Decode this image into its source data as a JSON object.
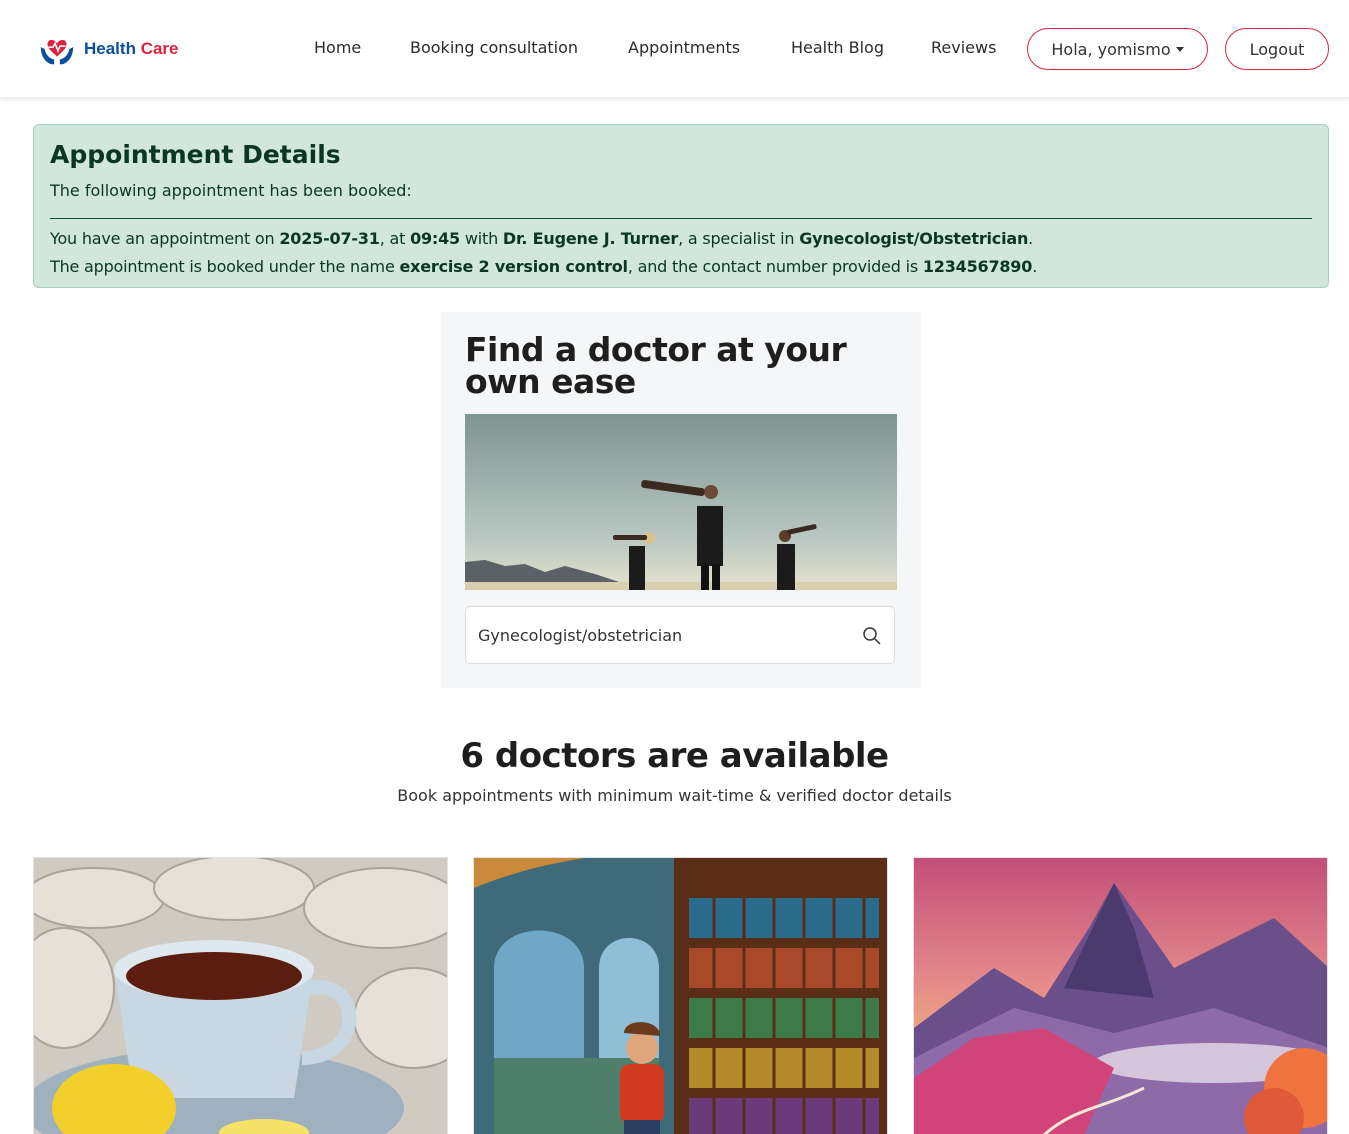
{
  "brand": {
    "icon": "heart-hands-logo",
    "name_part1": "Health",
    "name_part2": "Care"
  },
  "nav": {
    "links": [
      "Home",
      "Booking consultation",
      "Appointments",
      "Health Blog",
      "Reviews"
    ],
    "user_menu": "Hola, yomismo",
    "logout": "Logout"
  },
  "alert": {
    "title": "Appointment Details",
    "subtitle": "The following appointment has been booked:",
    "line1": {
      "prefix": "You have an appointment on ",
      "date": "2025-07-31",
      "at": ", at ",
      "time": "09:45",
      "with": " with ",
      "doctor": "Dr. Eugene J. Turner",
      "spec_text": ", a specialist in ",
      "specialty": "Gynecologist/Obstetrician",
      "end": "."
    },
    "line2": {
      "prefix": "The appointment is booked under the name ",
      "name": "exercise 2 version control",
      "mid": ", and the contact number provided is ",
      "phone": "1234567890",
      "end": "."
    }
  },
  "finder": {
    "title": "Find a doctor at your own ease",
    "search_value": "Gynecologist/obstetrician",
    "search_icon": "search-icon"
  },
  "doctors": {
    "heading": "6 doctors are available",
    "subheading": "Book appointments with minimum wait-time & verified doctor details"
  },
  "colors": {
    "brand_blue": "#0b4f9c",
    "brand_red": "#d7263d",
    "alert_bg": "#d1e7dd",
    "alert_text": "#0a3622"
  }
}
